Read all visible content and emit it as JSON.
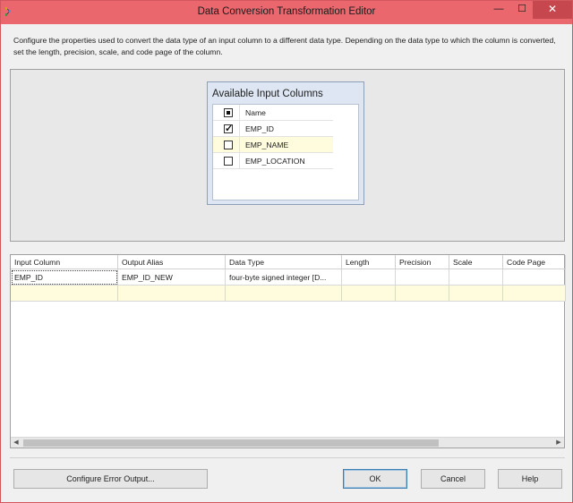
{
  "window": {
    "title": "Data Conversion Transformation Editor",
    "controls": {
      "minimize": "—",
      "maximize": "☐",
      "close": "✕"
    }
  },
  "description": "Configure the properties used to convert the data type of an input column to a different data type. Depending on the data type to which the column is converted, set the length, precision, scale, and code page of the column.",
  "available_columns": {
    "title": "Available Input Columns",
    "header": "Name",
    "items": [
      {
        "label": "EMP_ID",
        "checked": true
      },
      {
        "label": "EMP_NAME",
        "checked": false
      },
      {
        "label": "EMP_LOCATION",
        "checked": false
      }
    ]
  },
  "grid": {
    "columns": [
      "Input Column",
      "Output Alias",
      "Data Type",
      "Length",
      "Precision",
      "Scale",
      "Code Page"
    ],
    "rows": [
      [
        "EMP_ID",
        "EMP_ID_NEW",
        "four-byte signed integer [D...",
        "",
        "",
        "",
        ""
      ]
    ]
  },
  "buttons": {
    "configure_error": "Configure Error Output...",
    "ok": "OK",
    "cancel": "Cancel",
    "help": "Help"
  },
  "colors": {
    "titlebar": "#e9676d",
    "new_row": "#fffbdd",
    "list_panel": "#dde6f2"
  }
}
